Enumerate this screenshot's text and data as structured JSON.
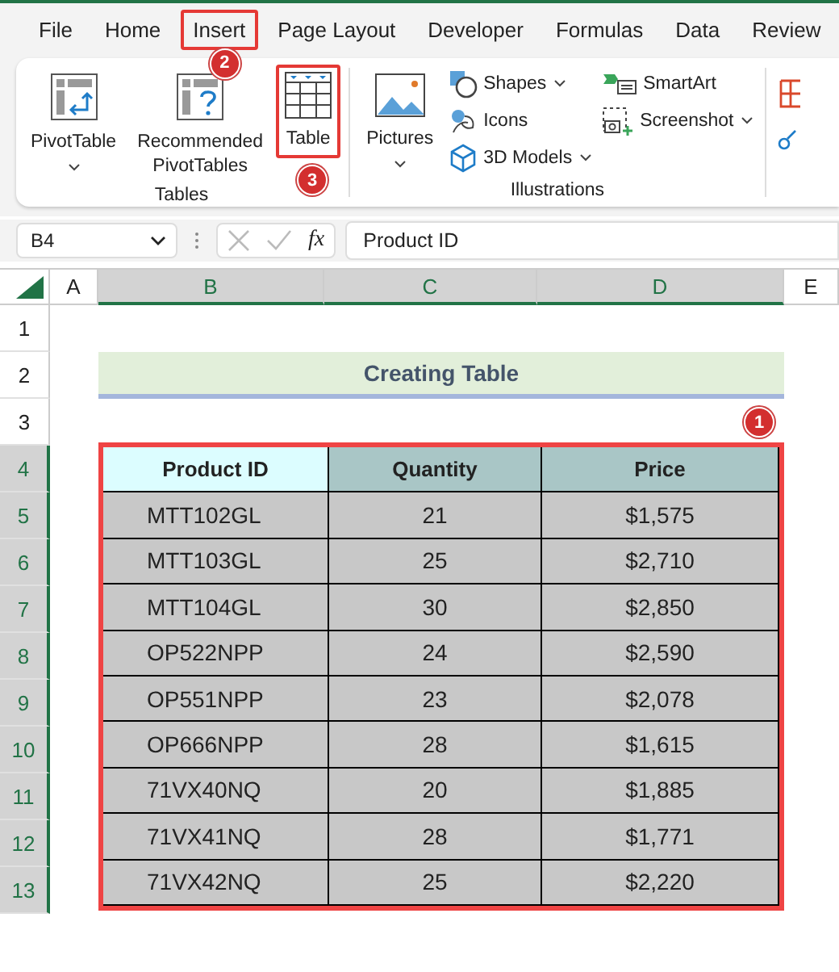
{
  "tabs": [
    {
      "label": "File",
      "highlighted": false
    },
    {
      "label": "Home",
      "highlighted": false
    },
    {
      "label": "Insert",
      "highlighted": true,
      "badge": "2"
    },
    {
      "label": "Page Layout",
      "highlighted": false
    },
    {
      "label": "Developer",
      "highlighted": false
    },
    {
      "label": "Formulas",
      "highlighted": false
    },
    {
      "label": "Data",
      "highlighted": false
    },
    {
      "label": "Review",
      "highlighted": false
    }
  ],
  "ribbon": {
    "groups": [
      {
        "label": "Tables",
        "large": [
          {
            "label": "PivotTable",
            "dropdown": true,
            "highlighted": false
          },
          {
            "label": "Recommended PivotTables",
            "dropdown": false,
            "highlighted": false
          },
          {
            "label": "Table",
            "dropdown": false,
            "highlighted": true,
            "badge": "3"
          }
        ]
      },
      {
        "label": "Illustrations",
        "large": [
          {
            "label": "Pictures",
            "dropdown": true,
            "highlighted": false
          }
        ],
        "small": [
          [
            {
              "label": "Shapes",
              "dropdown": true
            },
            {
              "label": "Icons",
              "dropdown": false
            },
            {
              "label": "3D Models",
              "dropdown": true
            }
          ],
          [
            {
              "label": "SmartArt",
              "dropdown": false
            },
            {
              "label": "Screenshot",
              "dropdown": true
            }
          ]
        ]
      }
    ]
  },
  "formula_bar": {
    "name_box": "B4",
    "function_label": "fx",
    "value": "Product ID"
  },
  "columns": [
    {
      "label": "A",
      "selected": false
    },
    {
      "label": "B",
      "selected": true
    },
    {
      "label": "C",
      "selected": true
    },
    {
      "label": "D",
      "selected": true
    },
    {
      "label": "E",
      "selected": false
    }
  ],
  "rows": [
    {
      "label": "1",
      "selected": false
    },
    {
      "label": "2",
      "selected": false
    },
    {
      "label": "3",
      "selected": false
    },
    {
      "label": "4",
      "selected": true
    },
    {
      "label": "5",
      "selected": true
    },
    {
      "label": "6",
      "selected": true
    },
    {
      "label": "7",
      "selected": true
    },
    {
      "label": "8",
      "selected": true
    },
    {
      "label": "9",
      "selected": true
    },
    {
      "label": "10",
      "selected": true
    },
    {
      "label": "11",
      "selected": true
    },
    {
      "label": "12",
      "selected": true
    },
    {
      "label": "13",
      "selected": true
    }
  ],
  "title": "Creating Table",
  "table": {
    "highlighted": true,
    "badge": "1",
    "columns": [
      {
        "label": "Product ID",
        "color": "#dcfdff"
      },
      {
        "label": "Quantity",
        "color": "#a9c6c6"
      },
      {
        "label": "Price",
        "color": "#a9c6c6"
      }
    ],
    "rows": [
      [
        "MTT102GL",
        "21",
        "$1,575"
      ],
      [
        "MTT103GL",
        "25",
        "$2,710"
      ],
      [
        "MTT104GL",
        "30",
        "$2,850"
      ],
      [
        "OP522NPP",
        "24",
        "$2,590"
      ],
      [
        "OP551NPP",
        "23",
        "$2,078"
      ],
      [
        "OP666NPP",
        "28",
        "$1,615"
      ],
      [
        "71VX40NQ",
        "20",
        "$1,885"
      ],
      [
        "71VX41NQ",
        "28",
        "$1,771"
      ],
      [
        "71VX42NQ",
        "25",
        "$2,220"
      ]
    ]
  }
}
